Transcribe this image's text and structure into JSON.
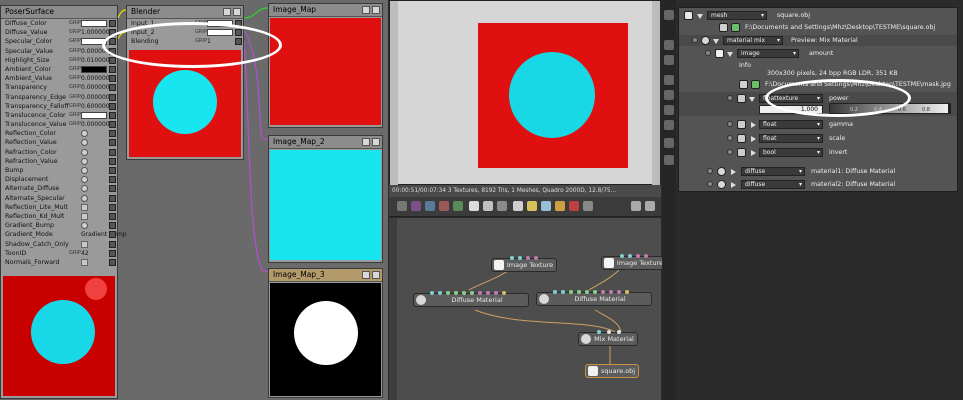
{
  "poser": {
    "surface_title": "PoserSurface",
    "blender_title": "Blender",
    "image_map_titles": [
      "Image_Map",
      "Image_Map_2",
      "Image_Map_3"
    ],
    "gmark": "GRIP",
    "surface_rows": [
      {
        "label": "Diffuse_Color",
        "kind": "swatch",
        "color": "#ffffff"
      },
      {
        "label": "Diffuse_Value",
        "kind": "value",
        "value": "1.000000"
      },
      {
        "label": "Specular_Color",
        "kind": "swatch",
        "color": "#ffffff"
      },
      {
        "label": "Specular_Value",
        "kind": "value",
        "value": "0.000000"
      },
      {
        "label": "Highlight_Size",
        "kind": "value",
        "value": "0.010000"
      },
      {
        "label": "Ambient_Color",
        "kind": "swatch",
        "color": "#000000"
      },
      {
        "label": "Ambient_Value",
        "kind": "value",
        "value": "0.000000"
      },
      {
        "label": "Transparency",
        "kind": "value",
        "value": "0.000000"
      },
      {
        "label": "Transparency_Edge",
        "kind": "value",
        "value": "0.000000"
      },
      {
        "label": "Transparency_Falloff",
        "kind": "value",
        "value": "0.600000"
      },
      {
        "label": "Translucence_Color",
        "kind": "swatch",
        "color": "#ffffff"
      },
      {
        "label": "Translucence_Value",
        "kind": "value",
        "value": "0.000000"
      },
      {
        "label": "Reflection_Color",
        "kind": "dot"
      },
      {
        "label": "Reflection_Value",
        "kind": "dot"
      },
      {
        "label": "Refraction_Color",
        "kind": "dot"
      },
      {
        "label": "Refraction_Value",
        "kind": "dot"
      },
      {
        "label": "Bump",
        "kind": "dot"
      },
      {
        "label": "Displacement",
        "kind": "dot"
      },
      {
        "label": "Alternate_Diffuse",
        "kind": "dot"
      },
      {
        "label": "Alternate_Specular",
        "kind": "dot"
      },
      {
        "label": "Reflection_Lite_Mult",
        "kind": "check"
      },
      {
        "label": "Reflection_Kd_Mult",
        "kind": "check"
      },
      {
        "label": "Gradient_Bump",
        "kind": "dot"
      },
      {
        "label": "Gradient_Mode",
        "kind": "text",
        "value": "Gradient Bump"
      },
      {
        "label": "Shadow_Catch_Only",
        "kind": "check"
      },
      {
        "label": "ToonID",
        "kind": "value",
        "value": "42"
      },
      {
        "label": "Normals_Forward",
        "kind": "check"
      }
    ],
    "blender_rows": [
      {
        "label": "Input_1",
        "kind": "swatch",
        "color": "#ffffff"
      },
      {
        "label": "Input_2",
        "kind": "swatch",
        "color": "#ffffff"
      },
      {
        "label": "Blending",
        "kind": "value",
        "value": "1"
      }
    ],
    "colors": {
      "red": "#e01010",
      "cyan": "#17e5f0",
      "black": "#000000",
      "white": "#ffffff"
    }
  },
  "viewport": {
    "status": "00:00:51/00:07:34    3 Textures, 8192 Tris, 1 Meshes, Quadro 2000D, 12.8/75..."
  },
  "graph": {
    "nodes": [
      {
        "label": "Image Texture"
      },
      {
        "label": "Image Texture"
      },
      {
        "label": "Diffuse Material"
      },
      {
        "label": "Diffuse Material"
      },
      {
        "label": "Mix Material"
      },
      {
        "label": "square.obj"
      }
    ]
  },
  "inspector": {
    "mesh_type": "mesh",
    "mesh_name": "square.obj",
    "path": "F:\\Documents and Settings\\Mhz\\Desktop\\TESTME\\square.obj",
    "material_type": "material mix",
    "preview_label": "Preview: Mix Material",
    "image_type": "image",
    "amount_label": "amount",
    "info_label": "Info",
    "info_text": "300x300 pixels, 24 bpp RGB LDR, 351 KB",
    "image_path": "F:\\Documents and Settings\\Mhz\\Desktop\\TESTME\\mask.jpg",
    "float_texture_type": "floattexture",
    "power_label": "power",
    "power_value": "1.000",
    "power_level": 1.0,
    "slider_ticks": [
      "0.2",
      "0.4",
      "0.6",
      "0.8"
    ],
    "gamma_type": "float",
    "gamma_label": "gamma",
    "scale_type": "float",
    "scale_label": "scale",
    "invert_type": "bool",
    "invert_label": "invert",
    "material1_type": "diffuse",
    "material1_label": "material1:  Diffuse Material",
    "material2_type": "diffuse",
    "material2_label": "material2:  Diffuse Material"
  }
}
